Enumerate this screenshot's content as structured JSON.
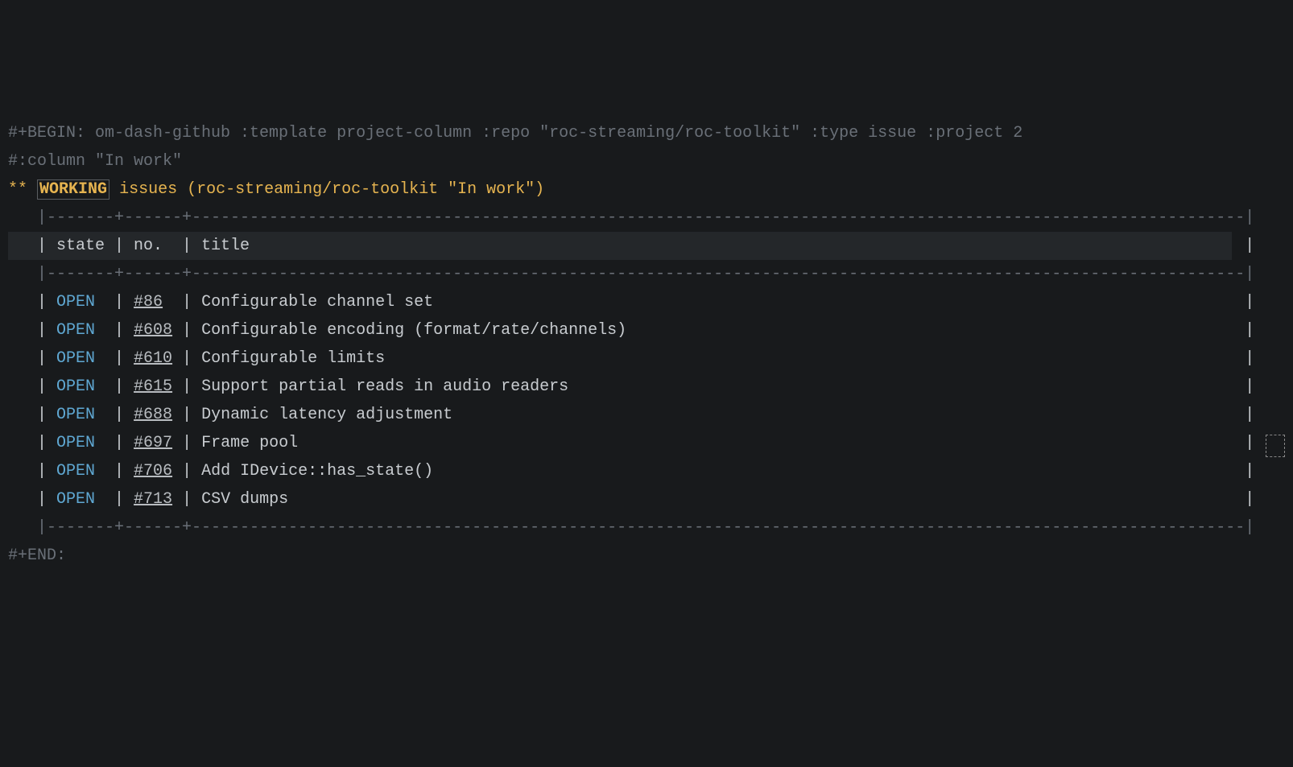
{
  "begin": "#+BEGIN: om-dash-github :template project-column :repo \"roc-streaming/roc-toolkit\" :type issue :project 2",
  "begin_cont": "#:column \"In work\"",
  "end": "#+END:",
  "heading": {
    "stars": "**",
    "tag": "WORKING",
    "text": "issues (roc-streaming/roc-toolkit \"In work\")"
  },
  "sep_top": "   |-------+------+-------------------------------------------------------------------------------------------------------------|",
  "header_row": "   | state | no.  | title                                                                                                       |",
  "sep_mid": "   |-------+------+-------------------------------------------------------------------------------------------------------------|",
  "sep_bot": "   |-------+------+-------------------------------------------------------------------------------------------------------------|",
  "rows": [
    {
      "state": "OPEN",
      "no": "#86",
      "pad": " ",
      "title": "Configurable channel set"
    },
    {
      "state": "OPEN",
      "no": "#608",
      "pad": "",
      "title": "Configurable encoding (format/rate/channels)"
    },
    {
      "state": "OPEN",
      "no": "#610",
      "pad": "",
      "title": "Configurable limits"
    },
    {
      "state": "OPEN",
      "no": "#615",
      "pad": "",
      "title": "Support partial reads in audio readers"
    },
    {
      "state": "OPEN",
      "no": "#688",
      "pad": "",
      "title": "Dynamic latency adjustment"
    },
    {
      "state": "OPEN",
      "no": "#697",
      "pad": "",
      "title": "Frame pool"
    },
    {
      "state": "OPEN",
      "no": "#706",
      "pad": "",
      "title": "Add IDevice::has_state()"
    },
    {
      "state": "OPEN",
      "no": "#713",
      "pad": "",
      "title": "CSV dumps"
    }
  ]
}
